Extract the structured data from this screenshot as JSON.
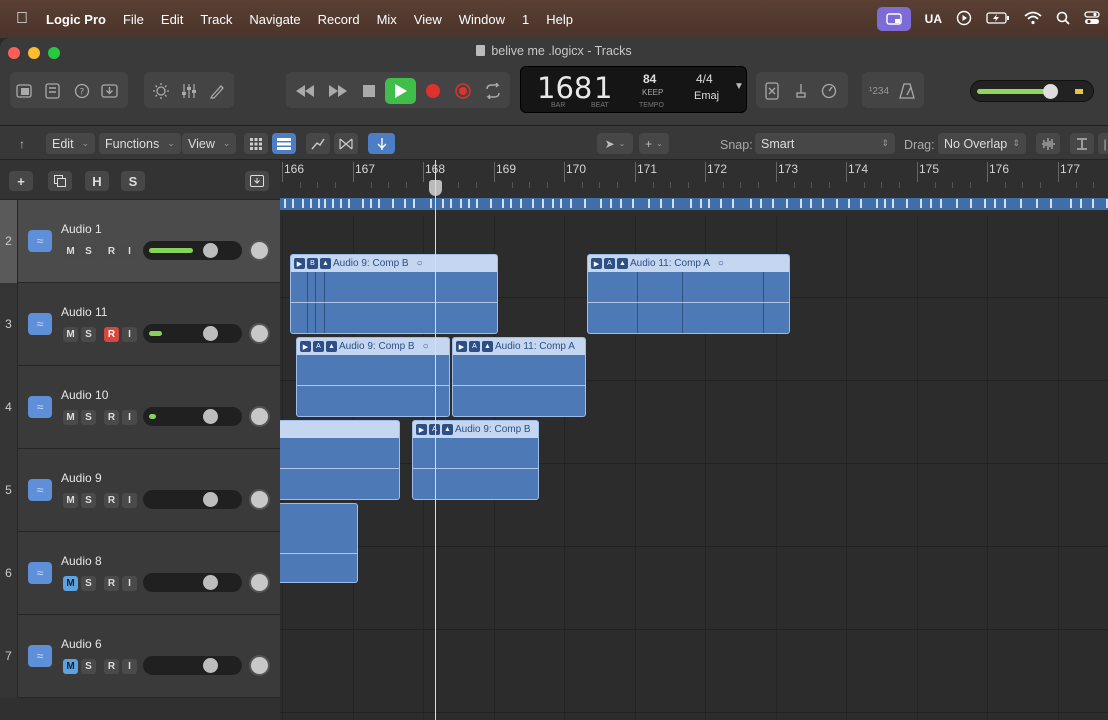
{
  "menubar": {
    "items": [
      "Logic Pro",
      "File",
      "Edit",
      "Track",
      "Navigate",
      "Record",
      "Mix",
      "View",
      "Window",
      "1",
      "Help"
    ],
    "status_ua": "UA"
  },
  "window": {
    "title": "belive me .logicx - Tracks"
  },
  "lcd": {
    "bar": "168",
    "beat": "1",
    "bar_label": "BAR",
    "beat_label": "BEAT",
    "tempo": "84",
    "keep": "KEEP",
    "tempo_label": "TEMPO",
    "signature": "4/4",
    "key": "Emaj"
  },
  "count_in": "¹234",
  "master_volume_fraction": 0.62,
  "toolsbar": {
    "edit": "Edit",
    "functions": "Functions",
    "view": "View",
    "snap_label": "Snap:",
    "snap_value": "Smart",
    "drag_label": "Drag:",
    "drag_value": "No Overlap"
  },
  "header_buttons": {
    "add": "+",
    "h": "H",
    "s": "S"
  },
  "tracks": [
    {
      "num": "2",
      "name": "Audio 1",
      "m": "M",
      "s": "S",
      "r": "R",
      "i": "I",
      "level": 0.5,
      "fader": 0.72
    },
    {
      "num": "3",
      "name": "Audio 11",
      "m": "M",
      "s": "S",
      "r": "R",
      "i": "I",
      "level": 0.15,
      "fader": 0.72
    },
    {
      "num": "4",
      "name": "Audio 10",
      "m": "M",
      "s": "S",
      "r": "R",
      "i": "I",
      "level": 0.08,
      "fader": 0.72
    },
    {
      "num": "5",
      "name": "Audio 9",
      "m": "M",
      "s": "S",
      "r": "R",
      "i": "I",
      "level": 0,
      "fader": 0.72
    },
    {
      "num": "6",
      "name": "Audio 8",
      "m": "M",
      "s": "S",
      "r": "R",
      "i": "I",
      "level": 0,
      "fader": 0.72
    },
    {
      "num": "7",
      "name": "Audio 6",
      "m": "M",
      "s": "S",
      "r": "R",
      "i": "I",
      "level": 0,
      "fader": 0.72
    }
  ],
  "ruler_bars": [
    "166",
    "167",
    "168",
    "169",
    "170",
    "171",
    "172",
    "173",
    "174",
    "175",
    "176",
    "177"
  ],
  "regions": {
    "r1": {
      "flags": [
        "▶",
        "B",
        "▲"
      ],
      "name": "Audio 9: Comp B",
      "end": "○"
    },
    "r2": {
      "flags": [
        "▶",
        "A",
        "▲"
      ],
      "name": "Audio 11: Comp A",
      "end": "○"
    },
    "r3": {
      "flags": [
        "▶",
        "A",
        "▲"
      ],
      "name": "Audio 9: Comp B",
      "end": "○"
    },
    "r4": {
      "flags": [
        "▶",
        "A",
        "▲"
      ],
      "name": "Audio 11: Comp A",
      "end": ""
    },
    "r5": {
      "flags": [
        "▶",
        "A",
        "▲"
      ],
      "name": "Audio 9: Comp B",
      "end": ""
    }
  },
  "colors": {
    "region": "#4d79b6",
    "accent_play": "#3fbf4a",
    "record": "#e0312c"
  }
}
